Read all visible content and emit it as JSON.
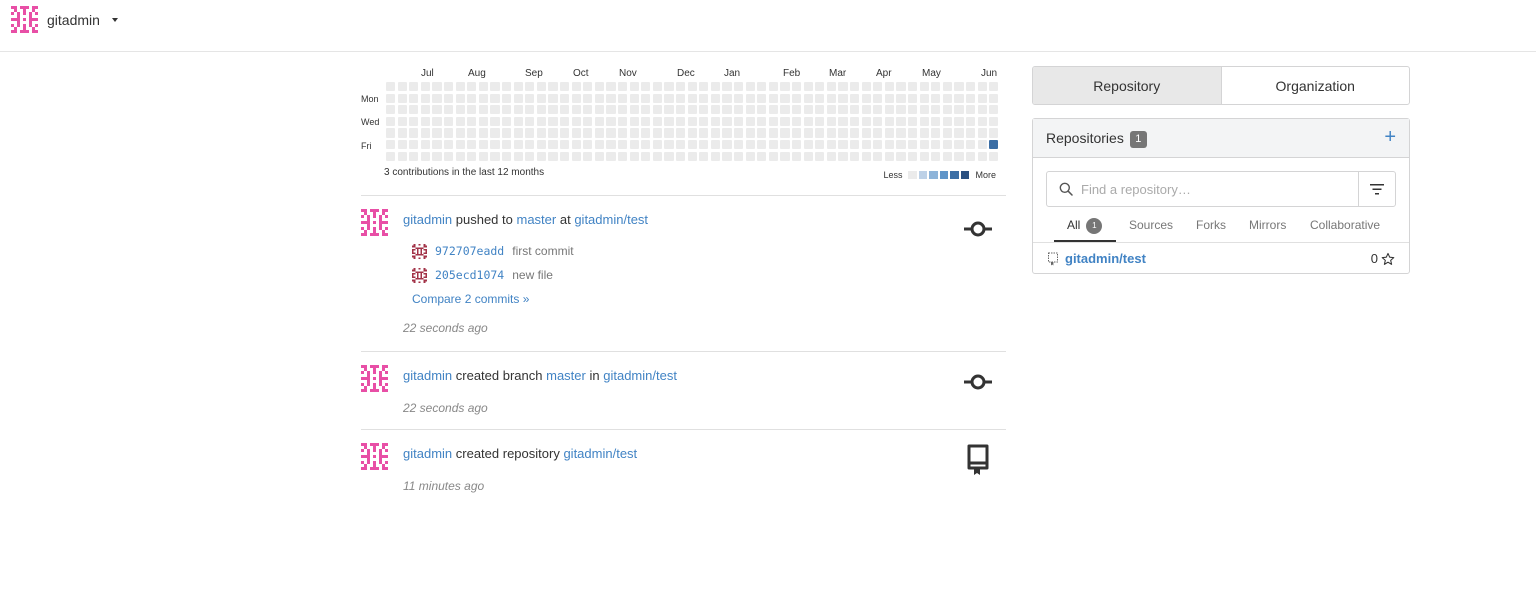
{
  "header": {
    "username": "gitadmin"
  },
  "heatmap": {
    "months": [
      "Jul",
      "Aug",
      "Sep",
      "Oct",
      "Nov",
      "Dec",
      "Jan",
      "Feb",
      "Mar",
      "Apr",
      "May",
      "Jun"
    ],
    "days": [
      "Mon",
      "Wed",
      "Fri"
    ],
    "summary": "3 contributions in the last 12 months",
    "legend_less": "Less",
    "legend_more": "More",
    "colors": [
      "#ebebeb",
      "#bdd1e7",
      "#8eb4d9",
      "#5f95c9",
      "#3b6ea5",
      "#2a5080"
    ],
    "active_level": 4
  },
  "feed": [
    {
      "user": "gitadmin",
      "action": "pushed to",
      "ref": "master",
      "prep": "at",
      "repo": "gitadmin/test",
      "commits": [
        {
          "sha": "972707eadd",
          "message": "first commit"
        },
        {
          "sha": "205ecd1074",
          "message": "new file"
        }
      ],
      "compare": "Compare 2 commits »",
      "time": "22 seconds ago",
      "icon": "commit-icon"
    },
    {
      "user": "gitadmin",
      "action": "created branch",
      "ref": "master",
      "prep": "in",
      "repo": "gitadmin/test",
      "time": "22 seconds ago",
      "icon": "commit-icon"
    },
    {
      "user": "gitadmin",
      "action": "created repository",
      "repo": "gitadmin/test",
      "time": "11 minutes ago",
      "icon": "repo-icon"
    }
  ],
  "sidebar": {
    "tabs": [
      "Repository",
      "Organization"
    ],
    "repos_title": "Repositories",
    "repos_count": "1",
    "search_placeholder": "Find a repository…",
    "filters": [
      "All",
      "Sources",
      "Forks",
      "Mirrors",
      "Collaborative"
    ],
    "all_count": "1",
    "repo": {
      "name": "gitadmin/test",
      "stars": "0"
    }
  }
}
